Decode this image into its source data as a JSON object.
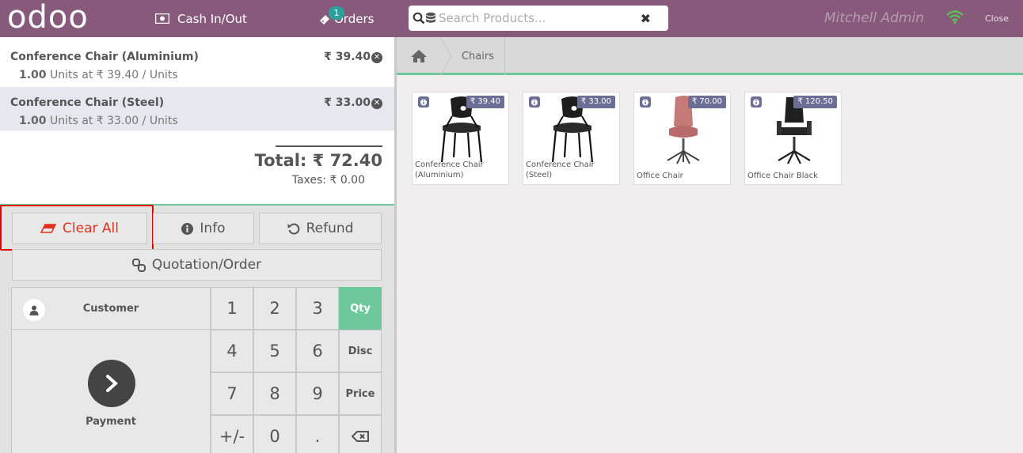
{
  "header": {
    "logo": "odoo",
    "cash_label": "Cash In/Out",
    "orders_label": "Orders",
    "orders_badge": "1",
    "search_placeholder": "Search Products...",
    "clear_search": "✖",
    "user_name": "Mitchell Admin",
    "close_label": "Close",
    "icons": [
      "cash-icon",
      "ticket-icon",
      "search-icon",
      "barcode-icon",
      "wifi-icon"
    ]
  },
  "order": {
    "lines": [
      {
        "name": "Conference Chair (Aluminium)",
        "price": "₹ 39.40",
        "qty": "1.00",
        "detail": "Units at ₹ 39.40 / Units",
        "selected": false
      },
      {
        "name": "Conference Chair (Steel)",
        "price": "₹ 33.00",
        "qty": "1.00",
        "detail": "Units at ₹ 33.00 / Units",
        "selected": true
      }
    ],
    "total": "Total: ₹ 72.40",
    "taxes": "Taxes: ₹ 0.00"
  },
  "controls": {
    "clear_all": "Clear All",
    "info": "Info",
    "refund": "Refund",
    "quotation": "Quotation/Order",
    "customer": "Customer",
    "payment": "Payment"
  },
  "numpad": {
    "keys": [
      "1",
      "2",
      "3",
      "4",
      "5",
      "6",
      "7",
      "8",
      "9",
      "+/-",
      "0",
      "."
    ],
    "modes": [
      "Qty",
      "Disc",
      "Price"
    ],
    "active_mode": "Qty",
    "backspace": "⌫"
  },
  "catalog": {
    "category": "Chairs",
    "products": [
      {
        "name": "Conference Chair (Aluminium)",
        "price": "₹ 39.40"
      },
      {
        "name": "Conference Chair (Steel)",
        "price": "₹ 33.00"
      },
      {
        "name": "Office Chair",
        "price": "₹ 70.00"
      },
      {
        "name": "Office Chair Black",
        "price": "₹ 120.50"
      }
    ]
  },
  "colors": {
    "brand": "#875a7b",
    "accent_green": "#6ec89b",
    "clear_red": "#e2311e",
    "highlight_red": "#e50000",
    "price_tag": "#6d6e96"
  }
}
